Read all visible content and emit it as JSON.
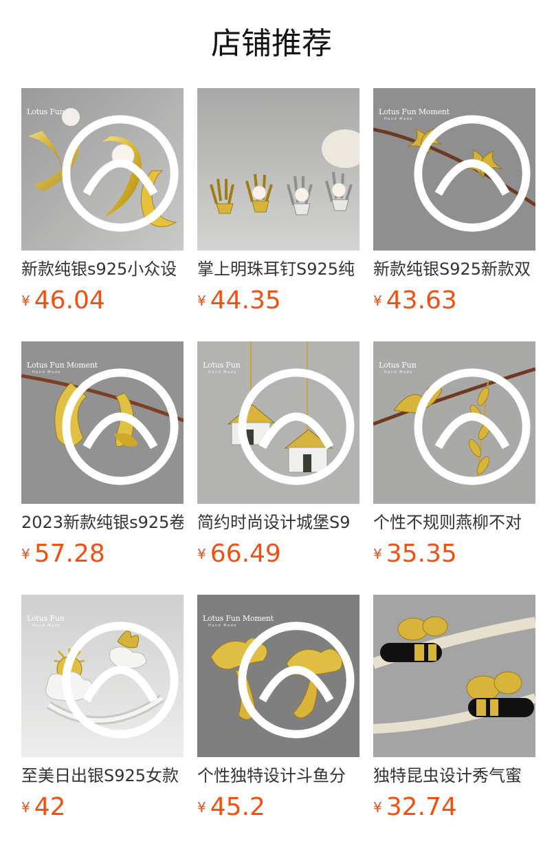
{
  "header": {
    "title": "店铺推荐"
  },
  "brand": {
    "currency_symbol": "¥",
    "price_color": "#f24f13"
  },
  "products": [
    {
      "title": "新款纯银s925小众设",
      "price": "46.04",
      "brand_logo": "Lotus Fun",
      "brand_sub": "",
      "image_icon": "moon-pearl-earrings-icon"
    },
    {
      "title": "掌上明珠耳钉S925纯",
      "price": "44.35",
      "brand_logo": "",
      "brand_sub": "",
      "image_icon": "hand-pearl-earrings-icon"
    },
    {
      "title": "新款纯银S925新款双",
      "price": "43.63",
      "brand_logo": "Lotus Fun Moment",
      "brand_sub": "Hand Made",
      "image_icon": "double-moon-earrings-icon"
    },
    {
      "title": "2023新款纯银s925卷",
      "price": "57.28",
      "brand_logo": "Lotus Fun Moment",
      "brand_sub": "Hand Made",
      "image_icon": "gold-hoop-earrings-icon"
    },
    {
      "title": "简约时尚设计城堡S9",
      "price": "66.49",
      "brand_logo": "Lotus Fun",
      "brand_sub": "Hand Made",
      "image_icon": "house-drop-earrings-icon"
    },
    {
      "title": "个性不规则燕柳不对",
      "price": "35.35",
      "brand_logo": "Lotus Fun",
      "brand_sub": "Hand Made",
      "image_icon": "swallow-willow-earrings-icon"
    },
    {
      "title": "至美日出银S925女款",
      "price": "42",
      "brand_logo": "Lotus Fun",
      "brand_sub": "Hand Made",
      "image_icon": "sunrise-ring-icon"
    },
    {
      "title": "个性独特设计斗鱼分",
      "price": "45.2",
      "brand_logo": "Lotus Fun Moment",
      "brand_sub": "Hand Made",
      "image_icon": "fighting-fish-earrings-icon"
    },
    {
      "title": "独特昆虫设计秀气蜜",
      "price": "32.74",
      "brand_logo": "",
      "brand_sub": "",
      "image_icon": "bee-earrings-icon"
    }
  ]
}
